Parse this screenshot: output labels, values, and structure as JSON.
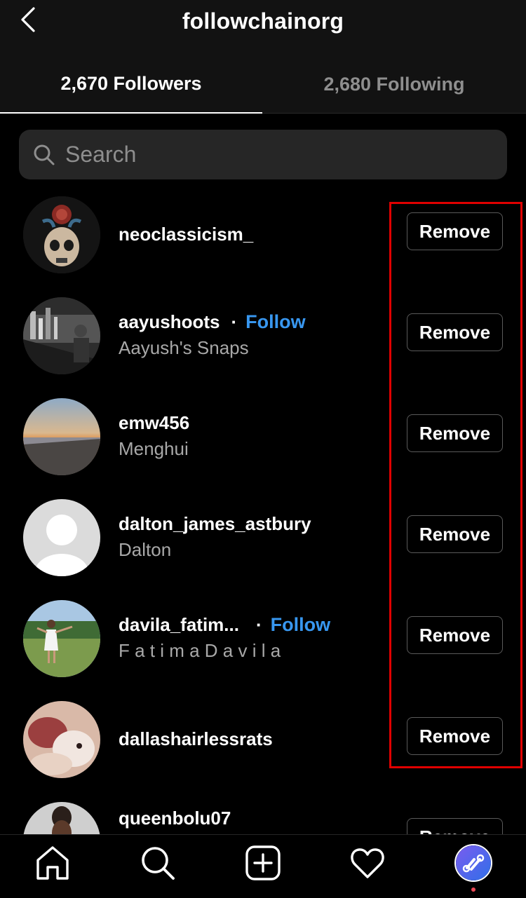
{
  "header": {
    "title": "followchainorg",
    "back_icon": "chevron-left-icon"
  },
  "tabs": {
    "followers_label": "2,670 Followers",
    "following_label": "2,680 Following"
  },
  "search": {
    "placeholder": "Search",
    "icon": "search-icon"
  },
  "followers": [
    {
      "username": "neoclassicism_",
      "full_name": "",
      "show_follow": false,
      "remove_label": "Remove"
    },
    {
      "username": "aayushoots",
      "full_name": "Aayush's Snaps",
      "show_follow": true,
      "follow_label": "Follow",
      "remove_label": "Remove"
    },
    {
      "username": "emw456",
      "full_name": "Menghui",
      "show_follow": false,
      "remove_label": "Remove"
    },
    {
      "username": "dalton_james_astbury",
      "full_name": "Dalton",
      "show_follow": false,
      "remove_label": "Remove"
    },
    {
      "username": "davila_fatim...",
      "full_name": "F a t i m a D a v i l a",
      "show_follow": true,
      "follow_label": "Follow",
      "remove_label": "Remove"
    },
    {
      "username": "dallashairlessrats",
      "full_name": "",
      "show_follow": false,
      "remove_label": "Remove"
    },
    {
      "username": "queenbolu07",
      "full_name": "",
      "show_follow": false,
      "remove_label": "Remove"
    }
  ],
  "dot_separator": "·",
  "bottom_nav": {
    "items": [
      "home-icon",
      "search-icon",
      "add-post-icon",
      "heart-icon",
      "profile-avatar"
    ],
    "notification_dot_color": "#ed4956"
  },
  "colors": {
    "accent_link": "#3897f0",
    "highlight": "#e00000",
    "background": "#000000"
  }
}
